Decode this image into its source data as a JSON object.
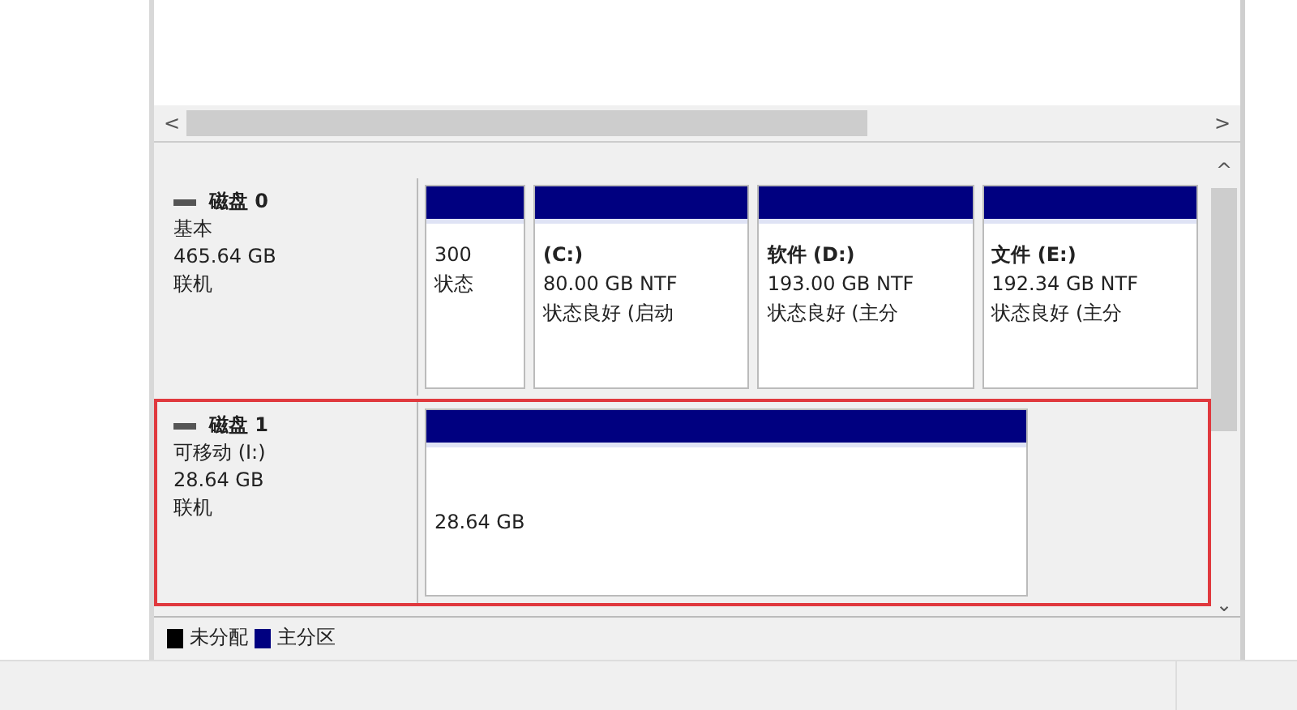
{
  "disks": [
    {
      "name": "磁盘 0",
      "type": "基本",
      "size": "465.64 GB",
      "status": "联机",
      "highlighted": false,
      "partitions": [
        {
          "size": "300",
          "status": "状态"
        },
        {
          "label": "(C:)",
          "size": "80.00 GB NTF",
          "status": "状态良好 (启动"
        },
        {
          "label": "软件  (D:)",
          "size": "193.00 GB NTF",
          "status": "状态良好 (主分"
        },
        {
          "label": "文件  (E:)",
          "size": "192.34 GB NTF",
          "status": "状态良好 (主分"
        }
      ]
    },
    {
      "name": "磁盘 1",
      "type": "可移动 (I:)",
      "size": "28.64 GB",
      "status": "联机",
      "highlighted": true,
      "partitions": [
        {
          "size": "28.64 GB"
        }
      ]
    }
  ],
  "legend": [
    {
      "label": "未分配",
      "color": "#000000"
    },
    {
      "label": "主分区",
      "color": "#000080"
    }
  ],
  "hscroll": {
    "left": "<",
    "right": ">"
  },
  "vscroll": {
    "up": "^",
    "down": "⌄"
  }
}
